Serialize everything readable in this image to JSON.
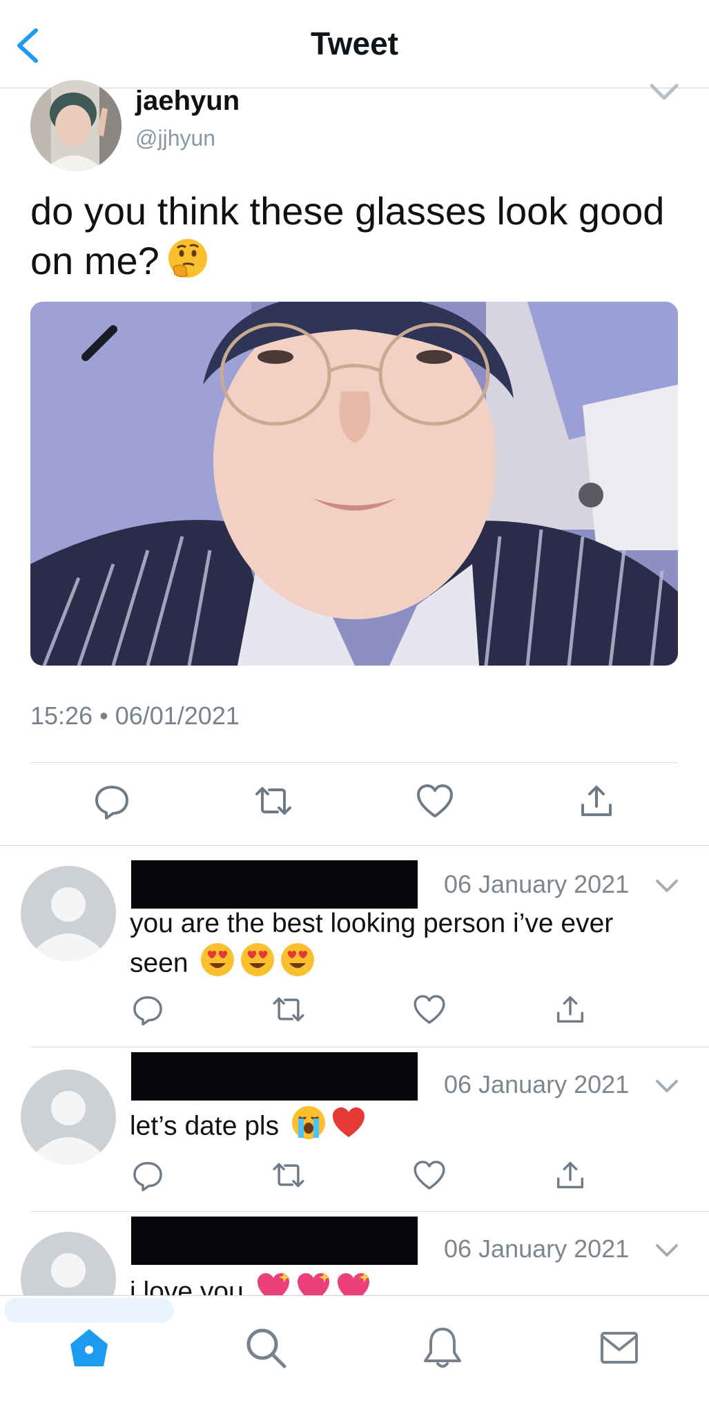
{
  "header": {
    "title": "Tweet"
  },
  "tweet": {
    "author_name": "jaehyun",
    "author_handle": "@jjhyun",
    "text": "do you think these glasses look good on me?",
    "timestamp": "15:26 • 06/01/2021",
    "actions": [
      "reply-icon",
      "retweet-icon",
      "like-icon",
      "share-icon"
    ]
  },
  "replies": [
    {
      "date": "06 January 2021",
      "text": "you are the best looking person i’ve ever seen",
      "emojis": [
        "heart-eyes",
        "heart-eyes",
        "heart-eyes"
      ]
    },
    {
      "date": "06 January 2021",
      "text": "let’s date pls",
      "emojis": [
        "loudly-crying",
        "red-heart"
      ]
    },
    {
      "date": "06 January 2021",
      "text": "i love you",
      "emojis": [
        "sparkling-heart",
        "sparkling-heart",
        "sparkling-heart"
      ]
    }
  ],
  "tabbar": {
    "tabs": [
      "home-icon",
      "search-icon",
      "notifications-icon",
      "messages-icon"
    ],
    "active": "home-icon"
  },
  "colors": {
    "accent": "#1d9bf0",
    "icon_gray": "#77828c",
    "redaction": "#07060a"
  }
}
